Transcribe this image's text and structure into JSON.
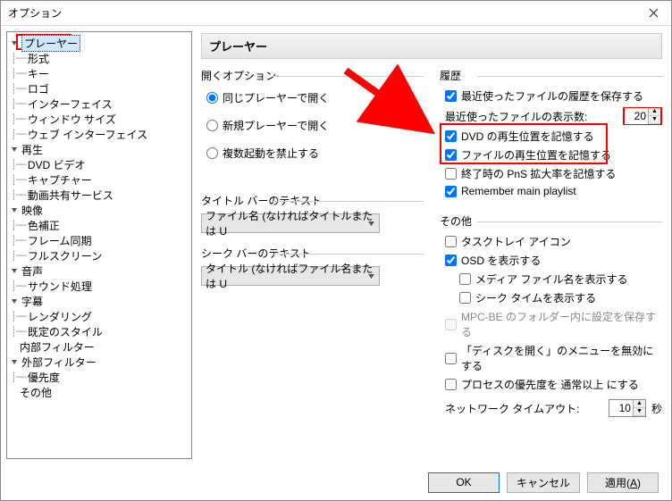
{
  "window": {
    "title": "オプション"
  },
  "tree": {
    "player": "プレーヤー",
    "format": "形式",
    "key": "キー",
    "logo": "ロゴ",
    "interface": "インターフェイス",
    "windowsize": "ウィンドウ サイズ",
    "webinterface": "ウェブ インターフェイス",
    "playback": "再生",
    "dvdvideo": "DVD ビデオ",
    "capture": "キャプチャー",
    "videoshare": "動画共有サービス",
    "video": "映像",
    "colorcorr": "色補正",
    "framesync": "フレーム同期",
    "fullscreen": "フルスクリーン",
    "audio": "音声",
    "soundproc": "サウンド処理",
    "subtitle": "字幕",
    "rendering": "レンダリング",
    "defaultstyle": "既定のスタイル",
    "internalfilter": "内部フィルター",
    "externalfilter": "外部フィルター",
    "priority": "優先度",
    "other": "その他"
  },
  "page": {
    "header": "プレーヤー",
    "open_group": "開くオプション",
    "open_same": "同じプレーヤーで開く",
    "open_new": "新規プレーヤーで開く",
    "open_prohibit": "複数起動を禁止する",
    "titlebar_group": "タイトル バーのテキスト",
    "titlebar_combo": "ファイル名 (なければタイトルまたは U",
    "seekbar_group": "シーク バーのテキスト",
    "seekbar_combo": "タイトル (なければファイル名または U",
    "history_group": "履歴",
    "history_recent": "最近使ったファイルの履歴を保存する",
    "history_count_label": "最近使ったファイルの表示数:",
    "history_count_value": "20",
    "history_dvd": "DVD の再生位置を記憶する",
    "history_file": "ファイルの再生位置を記憶する",
    "history_pns": "終了時の PnS 拡大率を記憶する",
    "history_playlist": "Remember main playlist",
    "misc_group": "その他",
    "misc_tray": "タスクトレイ アイコン",
    "misc_osd": "OSD を表示する",
    "misc_osd_filename": "メディア ファイル名を表示する",
    "misc_osd_seek": "シーク タイムを表示する",
    "misc_mpcbe": "MPC-BE のフォルダー内に設定を保存する",
    "misc_disc": "「ディスクを開く」のメニューを無効にする",
    "misc_priority": "プロセスの優先度を 通常以上 にする",
    "misc_timeout_label": "ネットワーク タイムアウト:",
    "misc_timeout_value": "10",
    "misc_timeout_unit": "秒"
  },
  "footer": {
    "ok": "OK",
    "cancel": "キャンセル",
    "apply": "適用(A)",
    "apply_underline": "A"
  }
}
